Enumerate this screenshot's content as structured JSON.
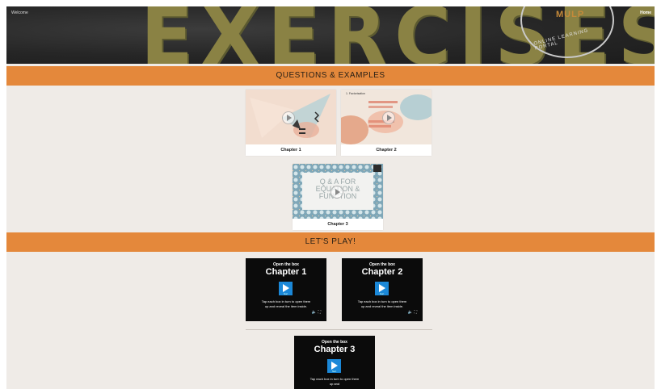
{
  "header": {
    "left_text": "Welcome",
    "right_text": "Home",
    "banner_title": "EXERCISES",
    "logo_abbr": "MULP",
    "logo_subtitle": "ONLINE LEARNING PORTAL"
  },
  "sections": [
    {
      "title": "QUESTIONS & EXAMPLES",
      "cards": [
        {
          "caption": "Chapter 1"
        },
        {
          "caption": "Chapter 2",
          "thumb_title": "1. Factorisation"
        },
        {
          "caption": "Chapter 3",
          "thumb_text": "Q & A FOR EQUATION & FUNCTION"
        }
      ]
    },
    {
      "title": "LET'S PLAY!",
      "games": [
        {
          "top": "Open the box",
          "title": "Chapter 1",
          "desc": "Tap each box in turn to open them up and reveal the item inside.",
          "play_label": "Start"
        },
        {
          "top": "Open the box",
          "title": "Chapter 2",
          "desc": "Tap each box in turn to open them up and reveal the item inside.",
          "play_label": "Start"
        },
        {
          "top": "Open the box",
          "title": "Chapter 3",
          "desc": "Tap each box in turn to open them up and",
          "play_label": "Start"
        }
      ]
    }
  ],
  "colors": {
    "section_bar": "#e4883b",
    "page_bg": "#efebe7",
    "play_button": "#1b88d8"
  }
}
